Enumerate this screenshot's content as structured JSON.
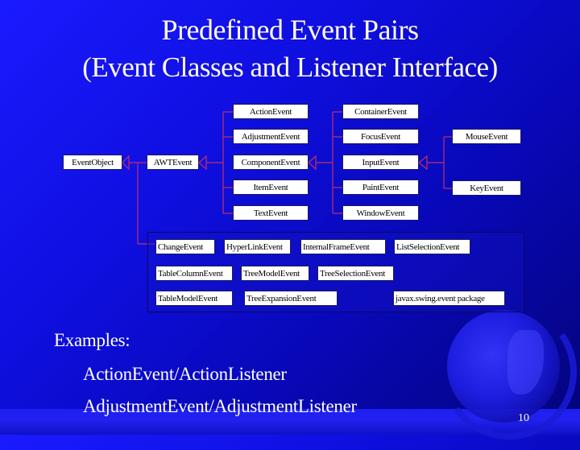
{
  "slide": {
    "title_line1": "Predefined Event Pairs",
    "title_line2": "(Event Classes and Listener Interface)",
    "page_number": "10",
    "colors": {
      "background": "#0f0fe0",
      "title_text": "#fffbe6",
      "connector": "#c0306a",
      "box_fill": "#ffffff"
    }
  },
  "diagram": {
    "root": "EventObject",
    "awt_event": "AWTEvent",
    "awt_children": [
      "ActionEvent",
      "AdjustmentEvent",
      "ComponentEvent",
      "ItemEvent",
      "TextEvent"
    ],
    "component_children": [
      "ContainerEvent",
      "FocusEvent",
      "InputEvent",
      "PaintEvent",
      "WindowEvent"
    ],
    "input_children": [
      "MouseEvent",
      "KeyEvent"
    ],
    "swing_events": {
      "row1": [
        "ChangeEvent",
        "HyperLinkEvent",
        "InternalFrameEvent",
        "ListSelectionEvent"
      ],
      "row2": [
        "TableColumnEvent",
        "TreeModelEvent",
        "TreeSelectionEvent"
      ],
      "row3": [
        "TableModelEvent",
        "TreeExpansionEvent"
      ],
      "package_label": "javax.swing.event package"
    }
  },
  "examples": {
    "heading": "Examples:",
    "items": [
      "ActionEvent/ActionListener",
      "AdjustmentEvent/AdjustmentListener"
    ]
  }
}
